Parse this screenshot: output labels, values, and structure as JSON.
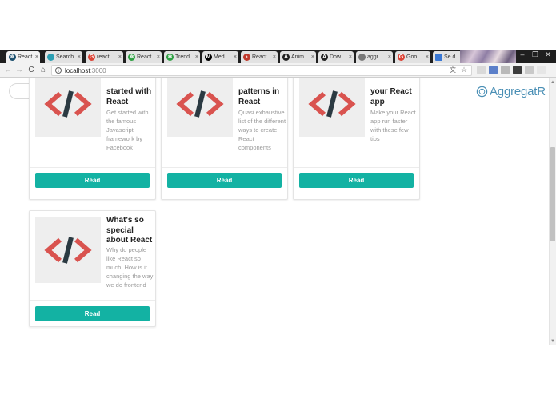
{
  "browser": {
    "tabs": [
      {
        "label": "React",
        "icon": "react-atom-icon",
        "color": "#1b4f6e",
        "active": true
      },
      {
        "label": "Search",
        "icon": "search-engine-icon",
        "color": "#2c9fb3",
        "active": false
      },
      {
        "label": "react",
        "icon": "google-icon",
        "color": "#db4437",
        "active": false
      },
      {
        "label": "React",
        "icon": "react-green-icon",
        "color": "#2ea043",
        "active": false
      },
      {
        "label": "Trend",
        "icon": "trends-icon",
        "color": "#2ea043",
        "active": false
      },
      {
        "label": "Med",
        "icon": "medium-icon",
        "color": "#000000",
        "active": false
      },
      {
        "label": "React",
        "icon": "react-red-icon",
        "color": "#c0392b",
        "active": false
      },
      {
        "label": "Anim",
        "icon": "letter-a-icon",
        "color": "#222222",
        "active": false
      },
      {
        "label": "Dow",
        "icon": "letter-a-icon",
        "color": "#222222",
        "active": false
      },
      {
        "label": "aggr",
        "icon": "blank-page-icon",
        "color": "#777777",
        "active": false
      },
      {
        "label": "Goo",
        "icon": "google-icon",
        "color": "#db4437",
        "active": false
      },
      {
        "label": "Se d",
        "icon": "windows-icon",
        "color": "#3a78d4",
        "active": false
      }
    ],
    "tab_close": "×",
    "window_controls": {
      "minimize": "–",
      "maximize": "❐",
      "close": "✕"
    },
    "nav": {
      "back": "←",
      "forward": "→",
      "reload": "C",
      "home": "⌂"
    },
    "url_host": "localhost",
    "url_port": ":3000",
    "info": "i",
    "translate": "文",
    "star": "☆"
  },
  "page": {
    "search_placeholder": "",
    "brand_name": "AggregatR",
    "read_label": "Read",
    "cards": [
      {
        "title": "started with React",
        "description": "Get started with the famous Javascript framework by Facebook"
      },
      {
        "title": "patterns in React",
        "description": "Quasi exhaustive list of the different ways to create React components"
      },
      {
        "title": "your React app",
        "description": "Make your React app run faster with these few tips"
      },
      {
        "title": "What's so special about React",
        "description": "Why do people like React so much. How is it changing the way we do frontend"
      }
    ]
  },
  "colors": {
    "accent": "#13b2a3",
    "brand": "#4a8fb5",
    "code_icon_red": "#d9534f",
    "code_icon_slash": "#2b3a42"
  }
}
